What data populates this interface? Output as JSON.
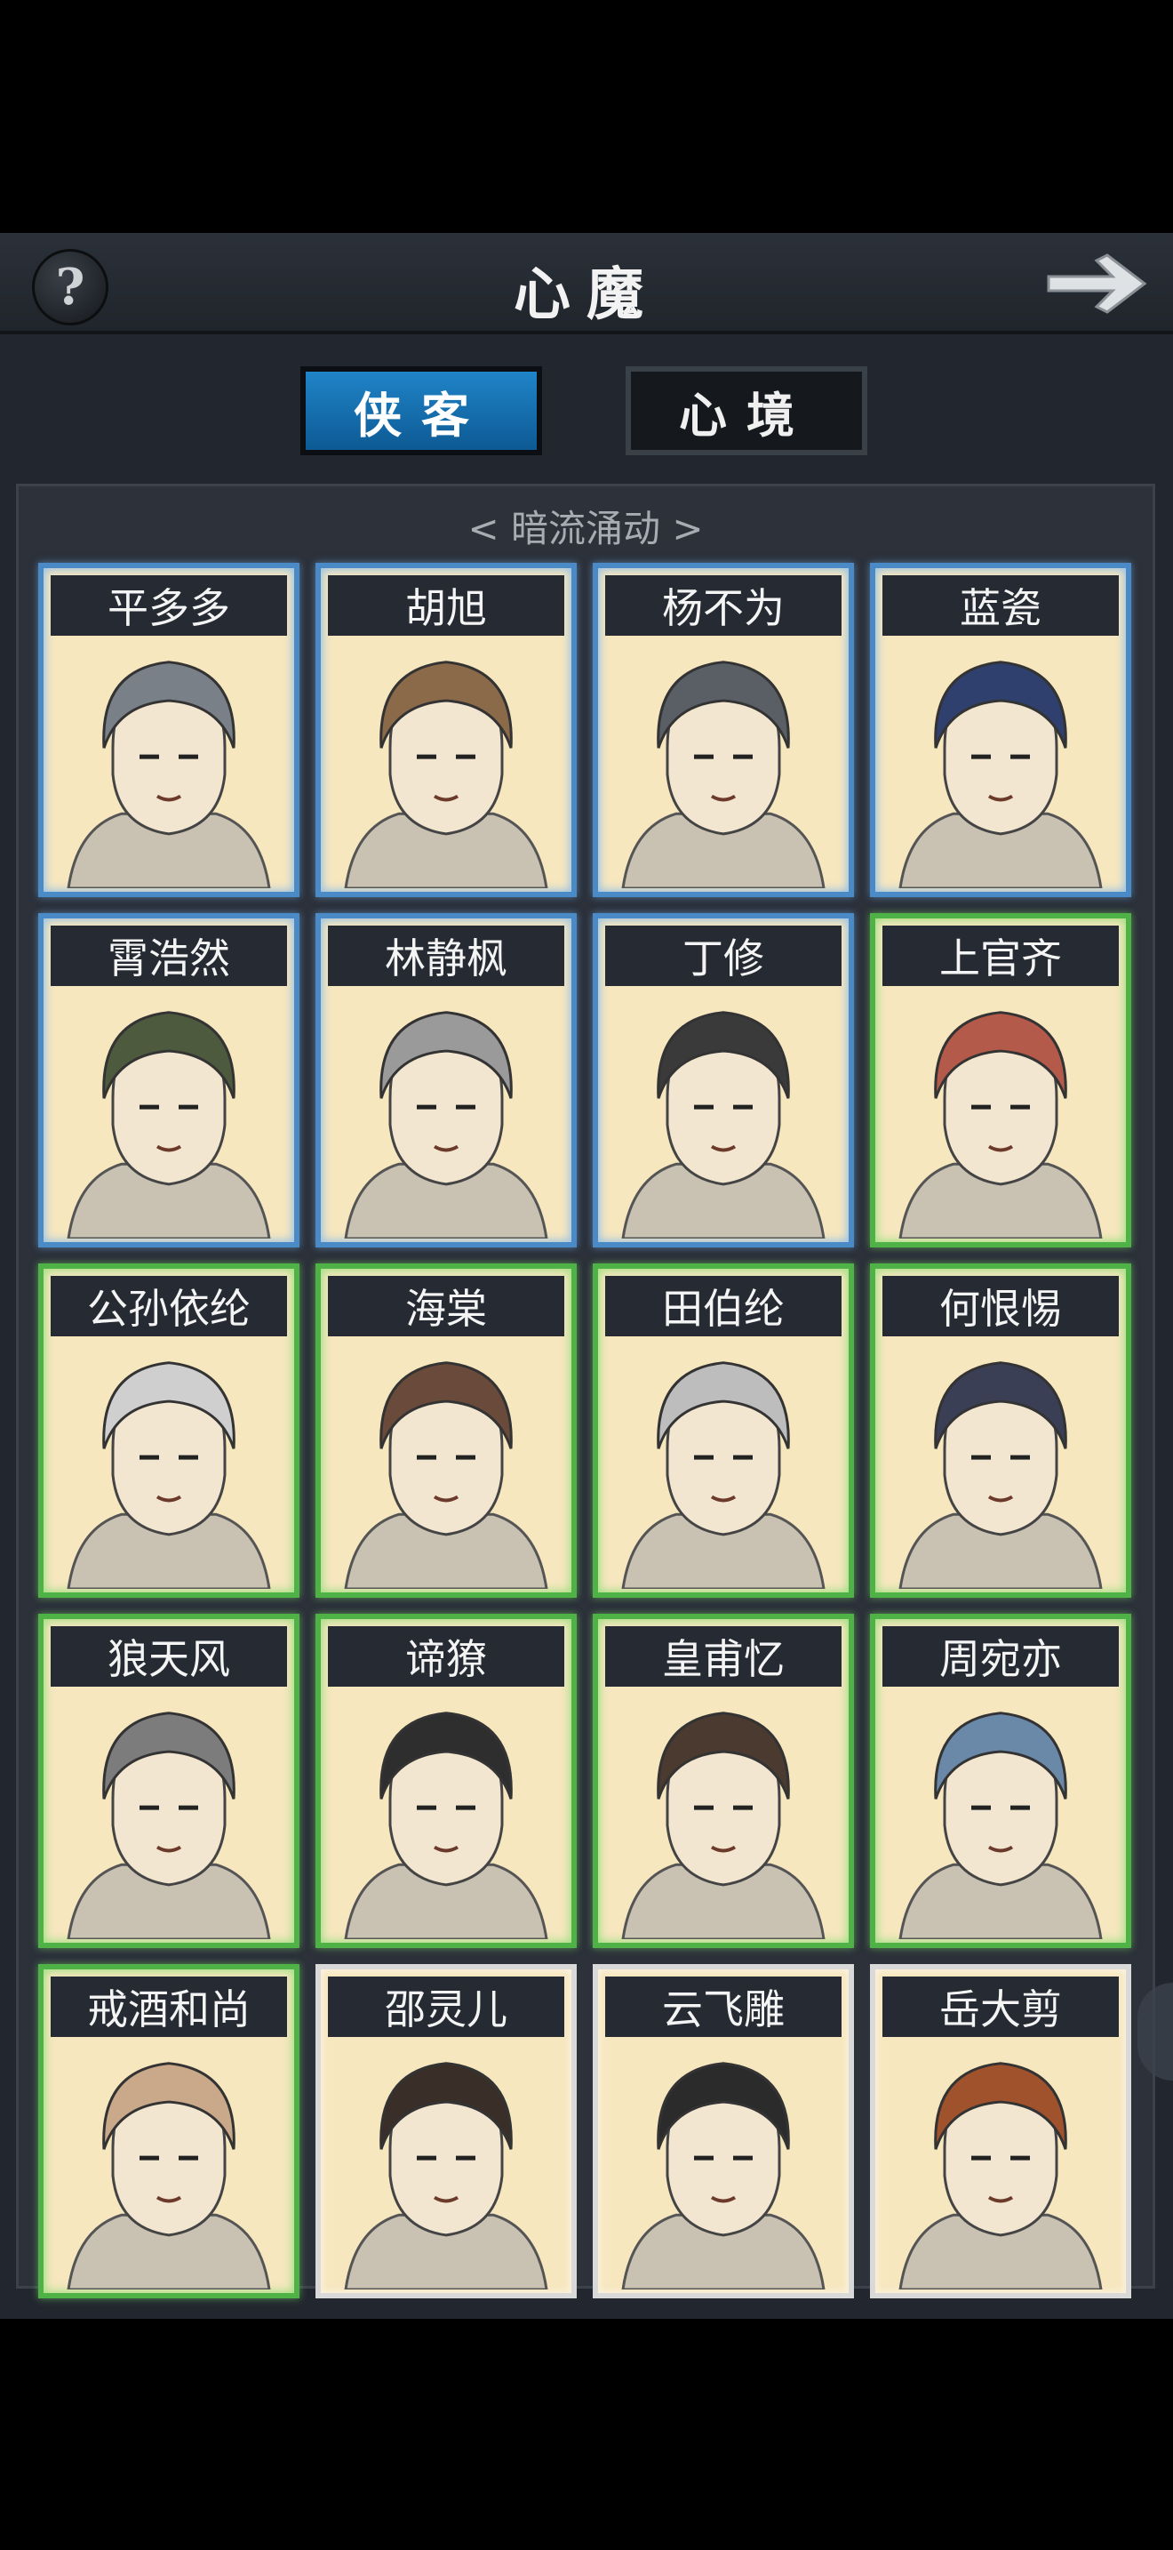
{
  "header": {
    "title": "心魔",
    "help_label": "?"
  },
  "tabs": [
    {
      "label": "侠客",
      "active": true
    },
    {
      "label": "心境",
      "active": false
    }
  ],
  "section": {
    "title": "< 暗流涌动 >"
  },
  "heroes": [
    {
      "name": "平多多",
      "frame": "blue"
    },
    {
      "name": "胡旭",
      "frame": "blue"
    },
    {
      "name": "杨不为",
      "frame": "blue"
    },
    {
      "name": "蓝瓷",
      "frame": "blue"
    },
    {
      "name": "霄浩然",
      "frame": "blue"
    },
    {
      "name": "林静枫",
      "frame": "blue"
    },
    {
      "name": "丁修",
      "frame": "blue"
    },
    {
      "name": "上官齐",
      "frame": "green"
    },
    {
      "name": "公孙依纶",
      "frame": "green"
    },
    {
      "name": "海棠",
      "frame": "green"
    },
    {
      "name": "田伯纶",
      "frame": "green"
    },
    {
      "name": "何恨惕",
      "frame": "green"
    },
    {
      "name": "狼天风",
      "frame": "green"
    },
    {
      "name": "谛獠",
      "frame": "green"
    },
    {
      "name": "皇甫忆",
      "frame": "green"
    },
    {
      "name": "周宛亦",
      "frame": "green"
    },
    {
      "name": "戒酒和尚",
      "frame": "green"
    },
    {
      "name": "邵灵儿",
      "frame": "white"
    },
    {
      "name": "云飞雕",
      "frame": "white"
    },
    {
      "name": "岳大剪",
      "frame": "white"
    }
  ]
}
